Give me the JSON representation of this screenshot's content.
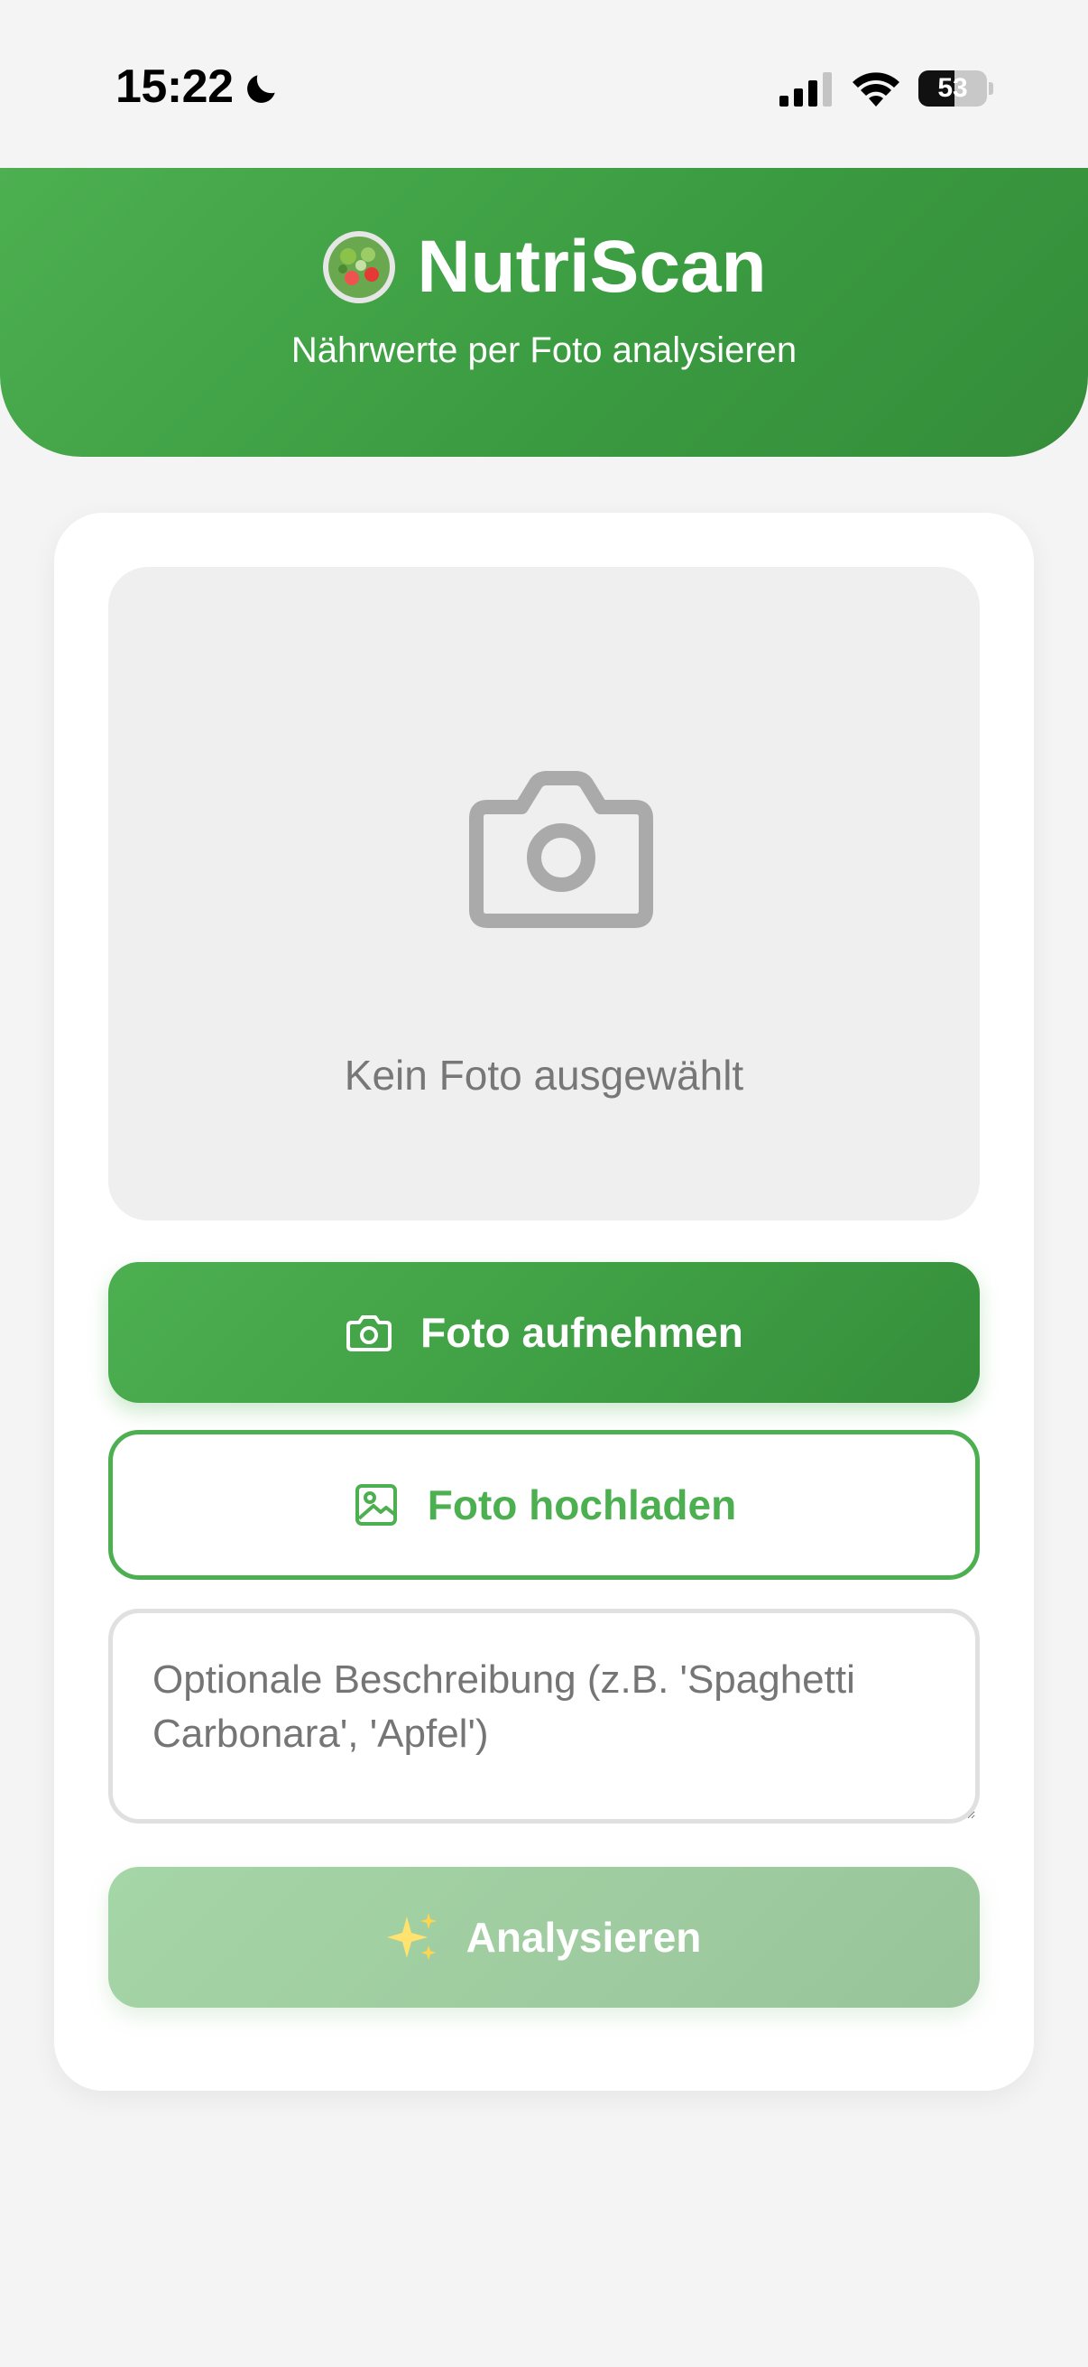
{
  "status_bar": {
    "time": "15:22",
    "battery": "53",
    "battery_level": 0.53
  },
  "header": {
    "title": "NutriScan",
    "subtitle": "Nährwerte per Foto analysieren",
    "logo_icon": "salad-bowl-icon"
  },
  "photo": {
    "placeholder": "Kein Foto ausgewählt",
    "icon": "camera-icon"
  },
  "buttons": {
    "take_photo": "Foto aufnehmen",
    "upload_photo": "Foto hochladen",
    "analyze": "Analysieren"
  },
  "description": {
    "placeholder": "Optionale Beschreibung (z.B. 'Spaghetti Carbonara', 'Apfel')",
    "value": ""
  },
  "colors": {
    "primary": "#4caf50",
    "primary_dark": "#388e3c",
    "disabled": "#a5d6a7",
    "background": "#f4f4f4"
  }
}
